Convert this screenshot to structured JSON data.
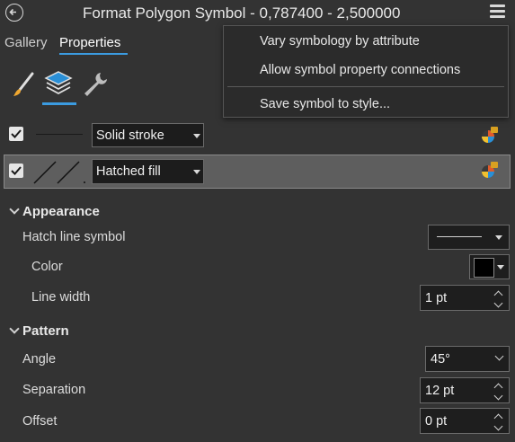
{
  "window": {
    "title": "Format Polygon Symbol - 0,787400 - 2,500000"
  },
  "tabs": [
    {
      "label": "Gallery",
      "active": false
    },
    {
      "label": "Properties",
      "active": true
    }
  ],
  "toolbar": {
    "icons": [
      "paintbrush-icon",
      "layers-icon",
      "wrench-icon"
    ],
    "active": "layers-icon"
  },
  "layers": [
    {
      "checked": true,
      "type": "Solid stroke",
      "preview": "solid-line"
    },
    {
      "checked": true,
      "type": "Hatched fill",
      "preview": "hatch",
      "selected": true
    }
  ],
  "menu": {
    "items": [
      "Vary symbology by attribute",
      "Allow symbol property connections",
      "Save symbol to style..."
    ]
  },
  "appearance": {
    "heading": "Appearance",
    "hatch_line_symbol_label": "Hatch line symbol",
    "color_label": "Color",
    "color_value": "#000000",
    "line_width_label": "Line width",
    "line_width_value": "1 pt"
  },
  "pattern": {
    "heading": "Pattern",
    "angle_label": "Angle",
    "angle_value": "45°",
    "separation_label": "Separation",
    "separation_value": "12 pt",
    "offset_label": "Offset",
    "offset_value": "0 pt"
  },
  "colors": {
    "accent": "#3b9be0",
    "background": "#333333",
    "selected_row": "#5e5e5e"
  }
}
